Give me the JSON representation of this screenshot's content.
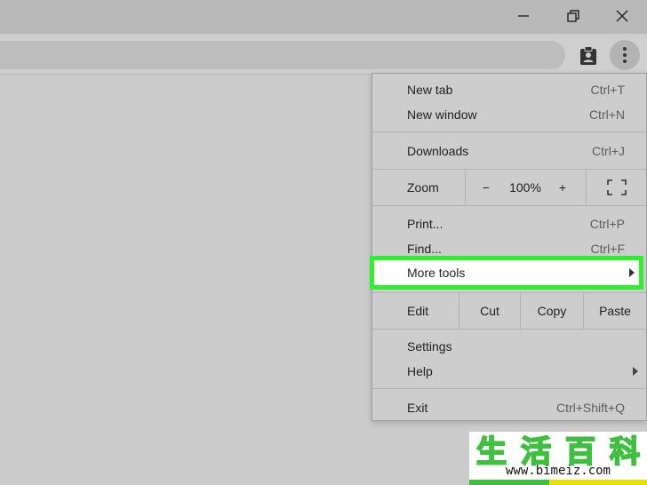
{
  "window_controls": {
    "minimize": "minimize-icon",
    "restore": "restore-icon",
    "close": "close-icon"
  },
  "toolbar": {
    "extension_icon": "clipboard-user-icon",
    "menu_icon": "kebab-menu-icon"
  },
  "menu": {
    "new_tab": {
      "label": "New tab",
      "shortcut": "Ctrl+T"
    },
    "new_window": {
      "label": "New window",
      "shortcut": "Ctrl+N"
    },
    "downloads": {
      "label": "Downloads",
      "shortcut": "Ctrl+J"
    },
    "zoom": {
      "label": "Zoom",
      "minus": "−",
      "value": "100%",
      "plus": "+",
      "fullscreen_icon": "fullscreen-icon"
    },
    "print": {
      "label": "Print...",
      "shortcut": "Ctrl+P"
    },
    "find": {
      "label": "Find...",
      "shortcut": "Ctrl+F"
    },
    "more_tools": {
      "label": "More tools"
    },
    "edit": {
      "label": "Edit",
      "cut": "Cut",
      "copy": "Copy",
      "paste": "Paste"
    },
    "settings": {
      "label": "Settings"
    },
    "help": {
      "label": "Help"
    },
    "exit": {
      "label": "Exit",
      "shortcut": "Ctrl+Shift+Q"
    }
  },
  "highlight_color": "#2ef02e",
  "watermark": {
    "chars": [
      "生",
      "活",
      "百",
      "科"
    ],
    "url": "www.bimeiz.com"
  }
}
